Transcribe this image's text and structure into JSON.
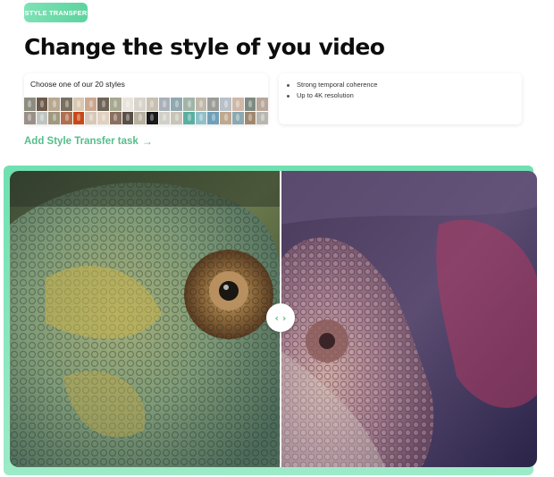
{
  "badge": {
    "label": "STYLE TRANSFER"
  },
  "heading": {
    "title": "Change the style of you video"
  },
  "styles_panel": {
    "label": "Choose one of our 20 styles",
    "thumb_colors": [
      "#8c8c80",
      "#6e5a4a",
      "#b8a890",
      "#7a7060",
      "#d8c8b0",
      "#caa890",
      "#6e6458",
      "#a8a890",
      "#e8e4dc",
      "#d8d4cc",
      "#c8c0b0",
      "#a8b0b8",
      "#90a8b0",
      "#a0b4a8",
      "#c0b8a8",
      "#9c9c98",
      "#b8c0c8",
      "#d0b8a8",
      "#7e8a82",
      "#b8a89a",
      "#9a9088",
      "#c0c4c0",
      "#a09880",
      "#b07050",
      "#c84818",
      "#d8c8b8",
      "#e0d0c0",
      "#8a7060",
      "#5a5048",
      "#b8b0a0",
      "#1a1a1a",
      "#d0d0c8",
      "#c8c4b8",
      "#5ab0a0",
      "#90c0c8",
      "#70a0b8",
      "#c0a890",
      "#8ca8b0",
      "#a08870",
      "#b8b8b0"
    ]
  },
  "features": [
    "Strong temporal coherence",
    "Up to 4K resolution"
  ],
  "add_task": {
    "label": "Add Style Transfer task",
    "arrow": "→"
  },
  "comparison": {
    "handle_label": "‹ ›",
    "handle_icon": "compare-arrows-icon"
  }
}
